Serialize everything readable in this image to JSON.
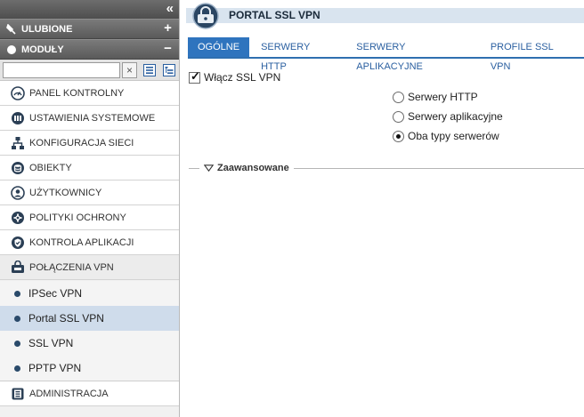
{
  "sidebar": {
    "favorites": {
      "label": "ULUBIONE",
      "action": "+"
    },
    "modules": {
      "label": "MODUŁY",
      "action": "−"
    },
    "search": {
      "placeholder": "",
      "value": "",
      "clear": "×"
    },
    "items": [
      {
        "label": "PANEL KONTROLNY",
        "icon": "dashboard-icon"
      },
      {
        "label": "USTAWIENIA SYSTEMOWE",
        "icon": "system-settings-icon"
      },
      {
        "label": "KONFIGURACJA SIECI",
        "icon": "network-icon"
      },
      {
        "label": "OBIEKTY",
        "icon": "database-icon"
      },
      {
        "label": "UŻYTKOWNICY",
        "icon": "user-icon"
      },
      {
        "label": "POLITYKI OCHRONY",
        "icon": "policy-icon"
      },
      {
        "label": "KONTROLA APLIKACJI",
        "icon": "shield-icon"
      },
      {
        "label": "POŁĄCZENIA VPN",
        "icon": "vpn-icon"
      }
    ],
    "vpn_sub": [
      {
        "label": "IPSec VPN",
        "selected": false
      },
      {
        "label": "Portal SSL VPN",
        "selected": true
      },
      {
        "label": "SSL VPN",
        "selected": false
      },
      {
        "label": "PPTP VPN",
        "selected": false
      }
    ],
    "admin": {
      "label": "ADMINISTRACJA",
      "icon": "admin-icon"
    }
  },
  "main": {
    "title": "PORTAL SSL VPN",
    "tabs": [
      {
        "label": "OGÓLNE",
        "active": true
      },
      {
        "label": "SERWERY HTTP",
        "active": false
      },
      {
        "label": "SERWERY APLIKACYJNE",
        "active": false
      },
      {
        "label": "PROFILE SSL VPN",
        "active": false
      }
    ],
    "enable_label": "Włącz SSL VPN",
    "enable_checked": true,
    "radios": [
      {
        "label": "Serwery HTTP",
        "checked": false
      },
      {
        "label": "Serwery aplikacyjne",
        "checked": false
      },
      {
        "label": "Oba typy serwerów",
        "checked": true
      }
    ],
    "advanced_label": "Zaawansowane"
  },
  "colors": {
    "accent": "#2f74be",
    "selected_row": "#cfdceb",
    "title_strip": "#d9e4ef"
  }
}
